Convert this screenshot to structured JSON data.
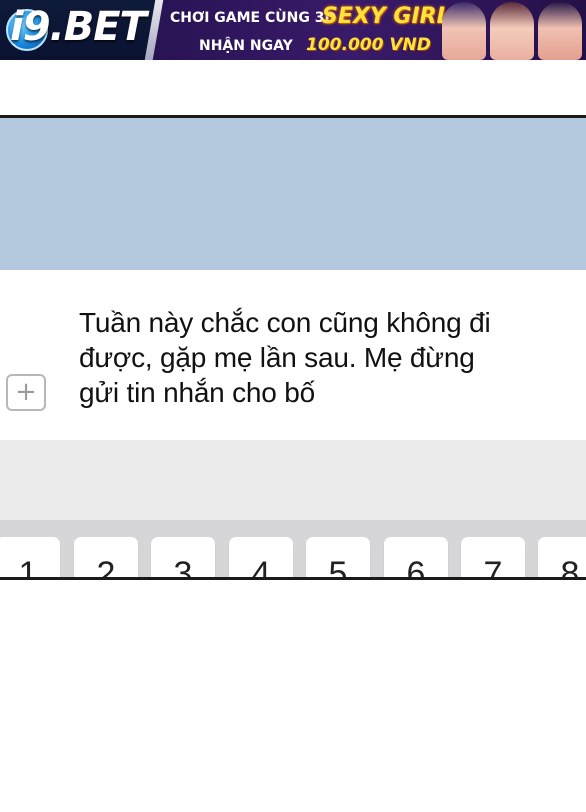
{
  "banner": {
    "logo_text": "i9.BET",
    "line1": "CHƠI GAME CÙNG 3D",
    "line1_highlight": "SEXY GIRL",
    "line2": "NHẬN NGAY",
    "line2_amount": "100.000 VND",
    "colors": {
      "background": "#2a1456",
      "highlight": "#ffe23a",
      "logo_badge": "#1a8be0"
    }
  },
  "chat": {
    "background_color": "#b4c8de",
    "add_icon": "+",
    "message": "Tuần này chắc con cũng không đi được, gặp mẹ lần sau. Mẹ đừng gửi tin nhắn cho bố"
  },
  "keyboard": {
    "keys": [
      "1",
      "2",
      "3",
      "4",
      "5",
      "6",
      "7",
      "8"
    ]
  }
}
